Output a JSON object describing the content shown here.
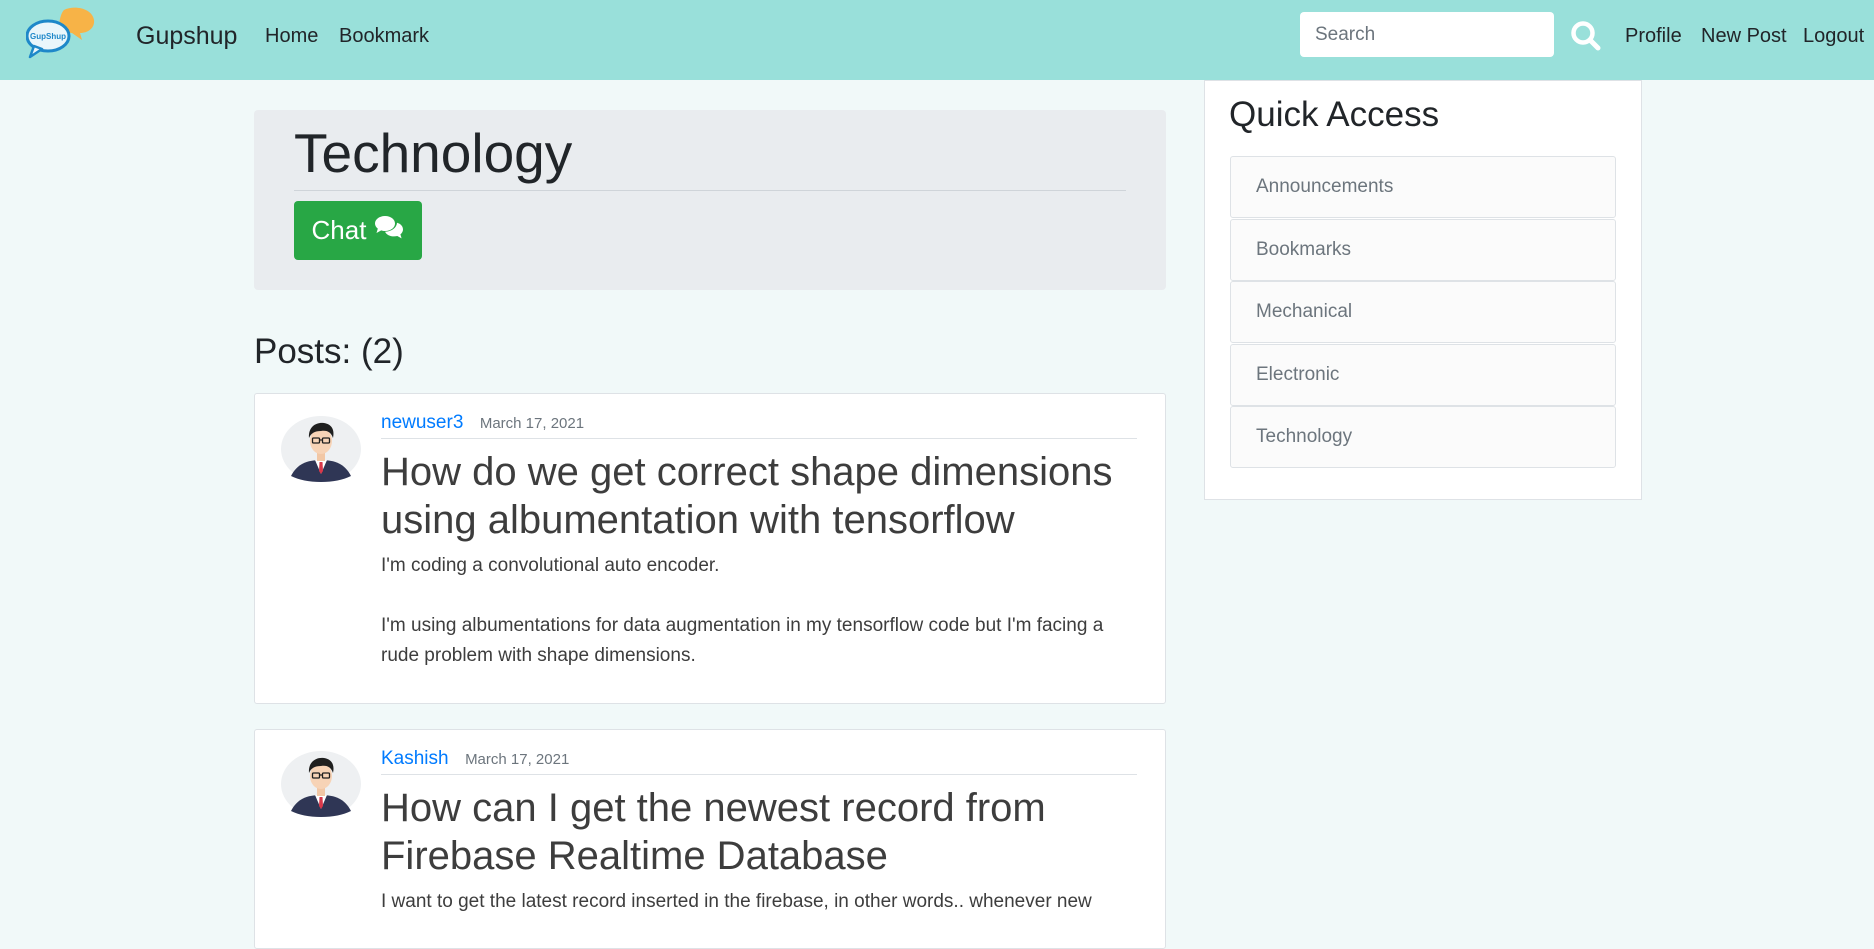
{
  "navbar": {
    "brand": "Gupshup",
    "logo_text": "GupShup",
    "links": [
      "Home",
      "Bookmark"
    ],
    "search_placeholder": "Search",
    "right_links": [
      "Profile",
      "New Post",
      "Logout"
    ],
    "accent_color": "#99e0da"
  },
  "category": {
    "title": "Technology",
    "chat_label": "Chat",
    "chat_icon": "comments-icon",
    "chat_color": "#28a745"
  },
  "posts_heading": "Posts: (2)",
  "posts": [
    {
      "author": "newuser3",
      "date": "March 17, 2021",
      "title": "How do we get correct shape dimensions using albumentation with tensorflow",
      "body": [
        "I'm coding a convolutional auto encoder.",
        "I'm using albumentations for data augmentation in my tensorflow code but I'm facing a rude problem with shape dimensions."
      ]
    },
    {
      "author": "Kashish",
      "date": "March 17, 2021",
      "title": "How can I get the newest record from Firebase Realtime Database",
      "body": [
        "I want to get the latest record inserted in the firebase, in other words.. whenever new"
      ]
    }
  ],
  "quick_access": {
    "title": "Quick Access",
    "items": [
      "Announcements",
      "Bookmarks",
      "Mechanical",
      "Electronic",
      "Technology"
    ]
  }
}
